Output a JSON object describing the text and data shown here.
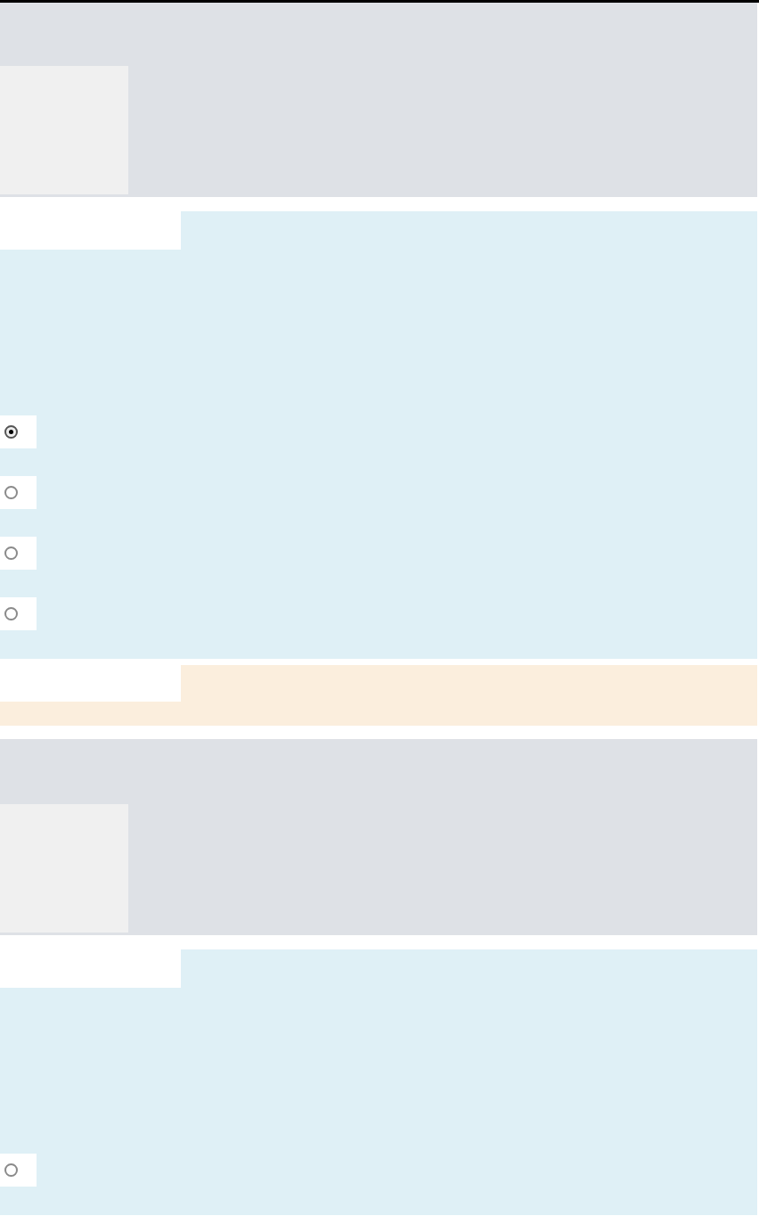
{
  "sections": [
    {
      "kind": "question",
      "options": [
        {
          "selected": true
        },
        {
          "selected": false
        },
        {
          "selected": false
        },
        {
          "selected": false
        }
      ]
    },
    {
      "kind": "feedback"
    },
    {
      "kind": "question",
      "options": [
        {
          "selected": false
        }
      ]
    }
  ]
}
